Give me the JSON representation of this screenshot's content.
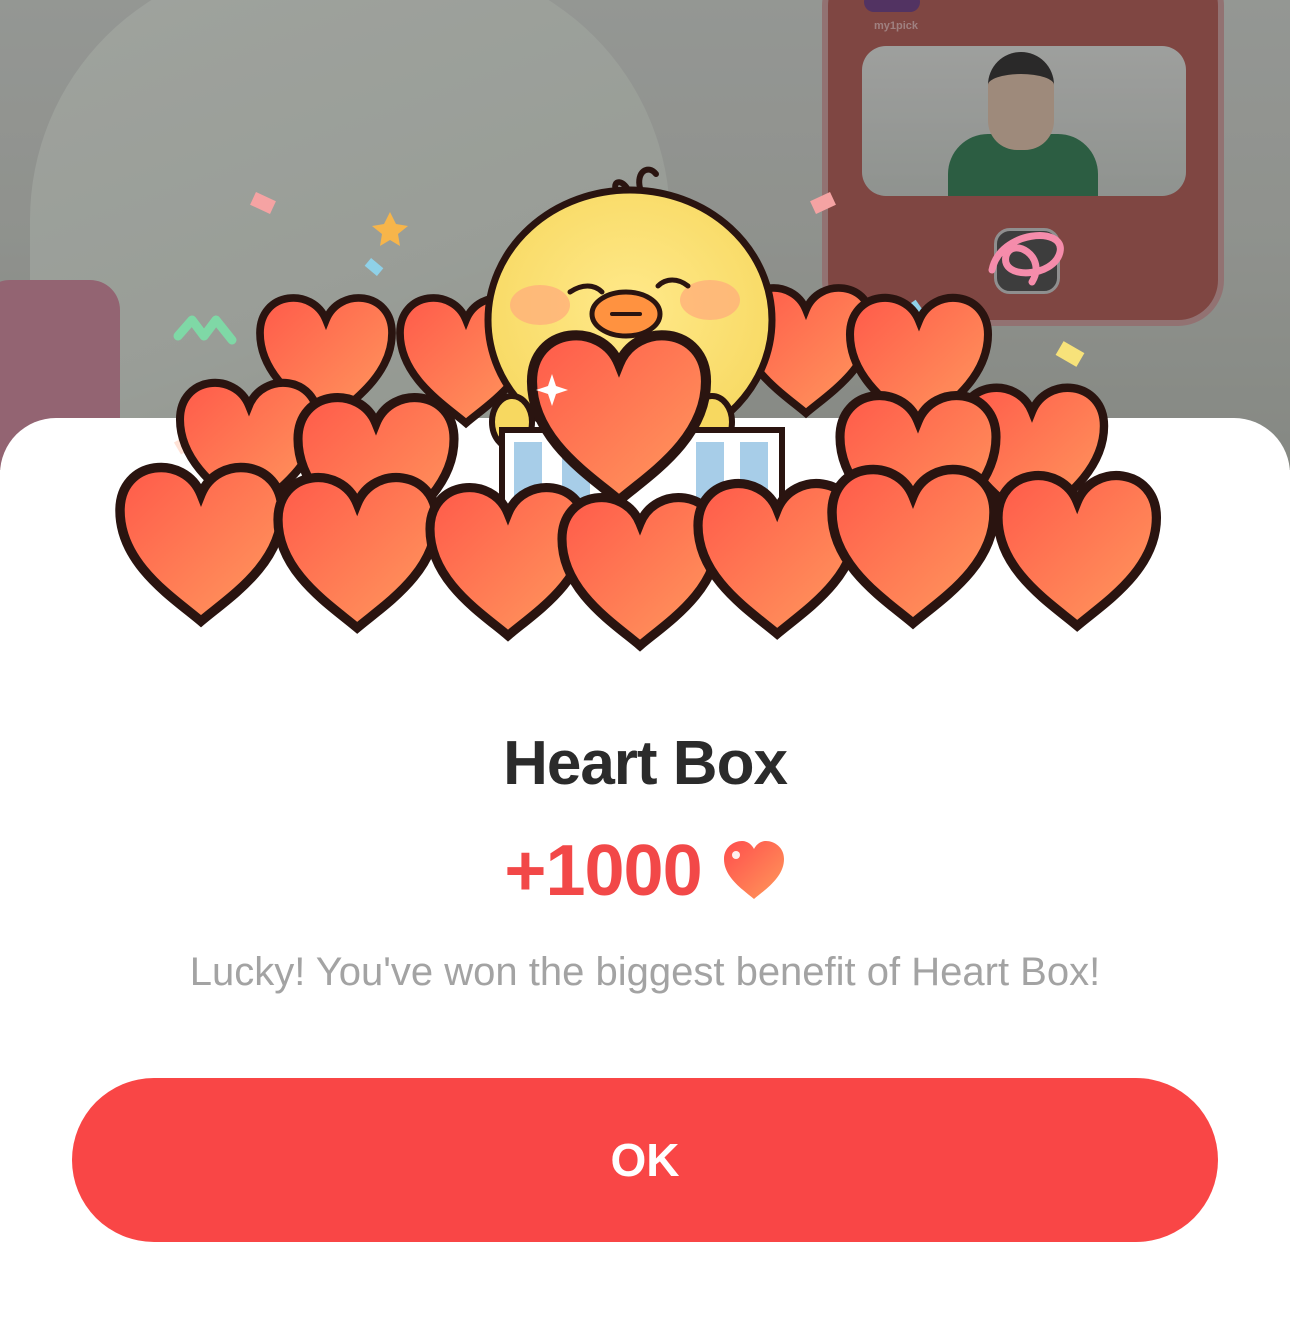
{
  "background": {
    "app_label": "my1pick"
  },
  "dialog": {
    "title": "Heart Box",
    "reward_amount": "+1000",
    "reward_icon": "heart-icon",
    "message": "Lucky! You've won the biggest benefit of Heart Box!",
    "ok_label": "OK"
  },
  "colors": {
    "accent": "#f94646",
    "heart_red": "#f24848",
    "title_text": "#2b2b2b",
    "message_text": "#a3a3a3"
  }
}
